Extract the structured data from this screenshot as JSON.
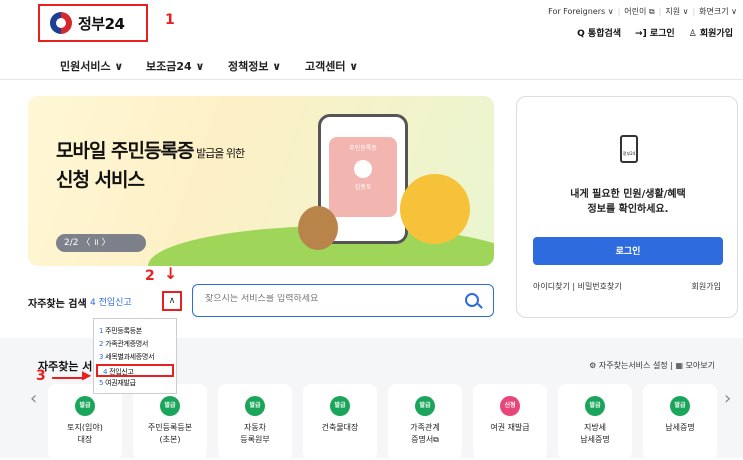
{
  "header": {
    "logo_text": "정부24",
    "util_links": [
      "For Foreigners ∨",
      "어린이 ⧉",
      "지원 ∨",
      "화면크기 ∨"
    ],
    "util_actions": [
      "Q 통합검색",
      "→] 로그인",
      "♙ 회원가입"
    ]
  },
  "annotations": [
    "1",
    "2",
    "3"
  ],
  "nav": [
    "민원서비스 ∨",
    "보조금24 ∨",
    "정책정보 ∨",
    "고객센터 ∨"
  ],
  "banner": {
    "title_line1": "모바일 주민등록증",
    "title_small": " 발급을 위한",
    "title_line2": "신청 서비스",
    "pager": "2/2  〈  ॥  〉",
    "phone_label": "주민등록증",
    "phone_name": "김총포"
  },
  "login_card": {
    "icon_label": "정부24",
    "text_line1": "내게 필요한 민원/생활/혜택",
    "text_line2": "정보를 확인하세요.",
    "login_button": "로그인",
    "links": "아이디찾기  |  비밀번호찾기",
    "join": "회원가입"
  },
  "freq_search": {
    "label": "자주찾는 검색",
    "selected": "4 전입신고",
    "chevron": "∧",
    "options": [
      {
        "num": "1",
        "label": "주민등록등본"
      },
      {
        "num": "2",
        "label": "가족관계증명서"
      },
      {
        "num": "3",
        "label": "세목별과세증명서"
      },
      {
        "num": "4",
        "label": "전입신고"
      },
      {
        "num": "5",
        "label": "여권재발급"
      }
    ]
  },
  "search": {
    "placeholder": "찾으시는 서비스를 입력하세요"
  },
  "services": {
    "title": "자주찾는 서비",
    "settings": "⚙ 자주찾는서비스 설정  |  ▦ 모아보기",
    "items": [
      {
        "badge": "발급",
        "label": "토지(임야)\n대장",
        "color": "green"
      },
      {
        "badge": "발급",
        "label": "주민등록등본\n(초본)",
        "color": "green"
      },
      {
        "badge": "발급",
        "label": "자동차\n등록원부",
        "color": "green"
      },
      {
        "badge": "발급",
        "label": "건축물대장",
        "color": "green"
      },
      {
        "badge": "발급",
        "label": "가족관계\n증명서⧉",
        "color": "green"
      },
      {
        "badge": "신청",
        "label": "여권 재발급",
        "color": "pink"
      },
      {
        "badge": "발급",
        "label": "지방세\n납세증명",
        "color": "green"
      },
      {
        "badge": "발급",
        "label": "납세증명",
        "color": "green"
      }
    ]
  },
  "colors": {
    "accent": "#2e6bdf",
    "annotation": "#e8201f",
    "badge_green": "#1aa55a",
    "badge_pink": "#e8457a"
  }
}
